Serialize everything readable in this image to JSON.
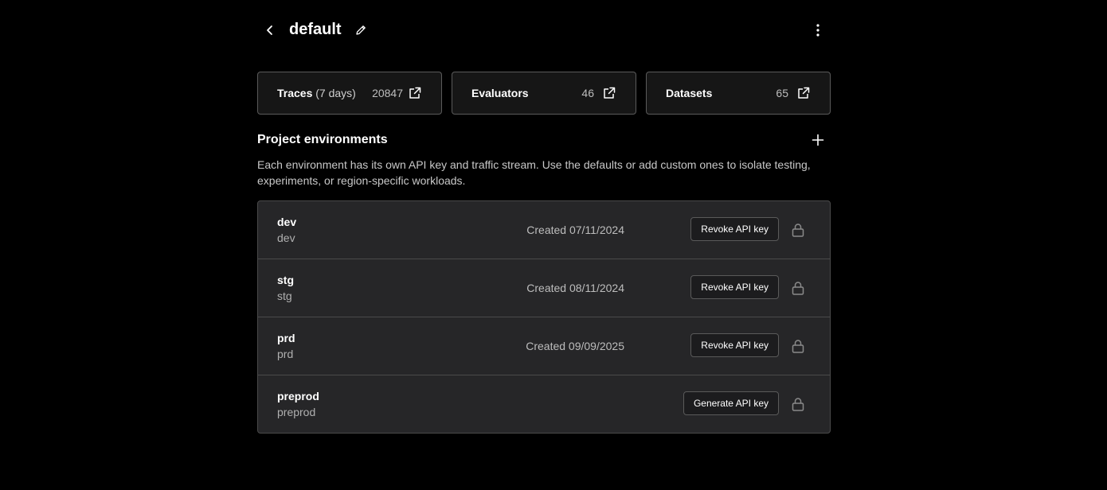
{
  "header": {
    "title": "default"
  },
  "stats": [
    {
      "label": "Traces",
      "sub": "(7 days)",
      "value": "20847"
    },
    {
      "label": "Evaluators",
      "sub": "",
      "value": "46"
    },
    {
      "label": "Datasets",
      "sub": "",
      "value": "65"
    }
  ],
  "section": {
    "title": "Project environments",
    "description": "Each environment has its own API key and traffic stream. Use the defaults or add custom ones to isolate testing, experiments, or region-specific workloads."
  },
  "environments": [
    {
      "name": "dev",
      "key": "dev",
      "created": "Created 07/11/2024",
      "action": "Revoke API key"
    },
    {
      "name": "stg",
      "key": "stg",
      "created": "Created 08/11/2024",
      "action": "Revoke API key"
    },
    {
      "name": "prd",
      "key": "prd",
      "created": "Created 09/09/2025",
      "action": "Revoke API key"
    },
    {
      "name": "preprod",
      "key": "preprod",
      "created": "",
      "action": "Generate API key"
    }
  ],
  "icons": {
    "back": "chevron-left-icon",
    "edit": "pencil-icon",
    "more": "more-vertical-icon",
    "external": "external-link-icon",
    "add": "plus-icon",
    "lock": "lock-icon"
  },
  "colors": {
    "background": "#000000",
    "card": "#161616",
    "list": "#262628",
    "border": "#4a4a4a",
    "muted": "#bdbdbd"
  }
}
